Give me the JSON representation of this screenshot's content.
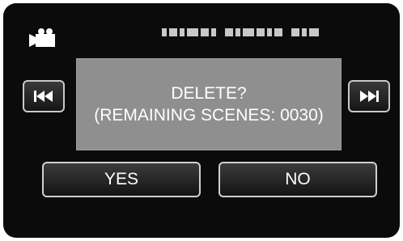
{
  "status_bar": {
    "mode_icon": "video-camera-icon",
    "date_time_icon": "masked-date-time"
  },
  "dialog": {
    "line1": "DELETE?",
    "line2": "(REMAINING SCENES: 0030)"
  },
  "navigation": {
    "prev_icon": "skip-previous-icon",
    "next_icon": "skip-next-icon"
  },
  "buttons": {
    "yes_label": "YES",
    "no_label": "NO"
  },
  "colors": {
    "screen_background": "#0b0b0b",
    "dialog_background": "#8f8f8f",
    "text": "#ffffff"
  }
}
